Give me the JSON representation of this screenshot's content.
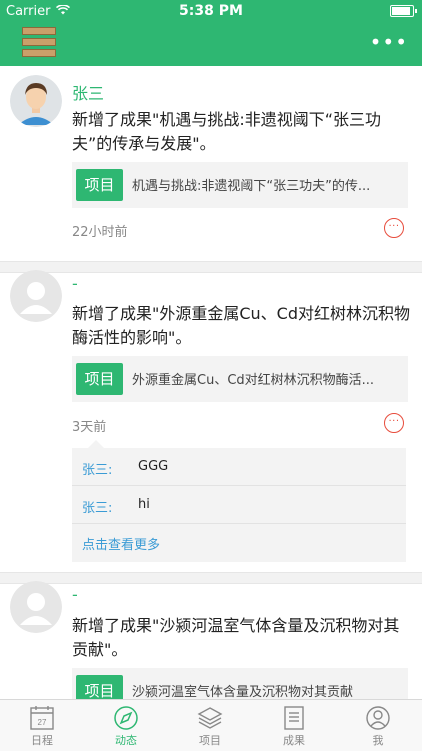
{
  "status_bar": {
    "carrier": "Carrier",
    "time": "5:38 PM"
  },
  "navbar": {
    "more_label": "•••"
  },
  "posts": [
    {
      "user": "张三",
      "content": "新增了成果\"机遇与挑战:非遗视阈下“张三功夫”的传承与发展\"。",
      "tag": "项目",
      "card_text": "机遇与挑战:非遗视阈下“张三功夫”的传...",
      "time": "22小时前",
      "more": "···"
    },
    {
      "user": "-",
      "content": "新增了成果\"外源重金属Cu、Cd对红树林沉积物酶活性的影响\"。",
      "tag": "项目",
      "card_text": "外源重金属Cu、Cd对红树林沉积物酶活...",
      "time": "3天前",
      "more": "···",
      "comments": [
        {
          "user": "张三:",
          "text": "GGG"
        },
        {
          "user": "张三:",
          "text": "hi"
        }
      ],
      "view_more": "点击查看更多"
    },
    {
      "user": "-",
      "content": "新增了成果\"沙颍河温室气体含量及沉积物对其贡献\"。",
      "tag": "项目",
      "card_text": "沙颍河温室气体含量及沉积物对其贡献"
    }
  ],
  "tabs": [
    {
      "label": "日程",
      "icon": "calendar-icon",
      "badge": "27"
    },
    {
      "label": "动态",
      "icon": "compass-icon",
      "active": true
    },
    {
      "label": "项目",
      "icon": "layers-icon"
    },
    {
      "label": "成果",
      "icon": "document-icon"
    },
    {
      "label": "我",
      "icon": "person-icon"
    }
  ],
  "colors": {
    "brand": "#2eb772",
    "link": "#3a9bd5",
    "alert": "#e74c3c"
  }
}
